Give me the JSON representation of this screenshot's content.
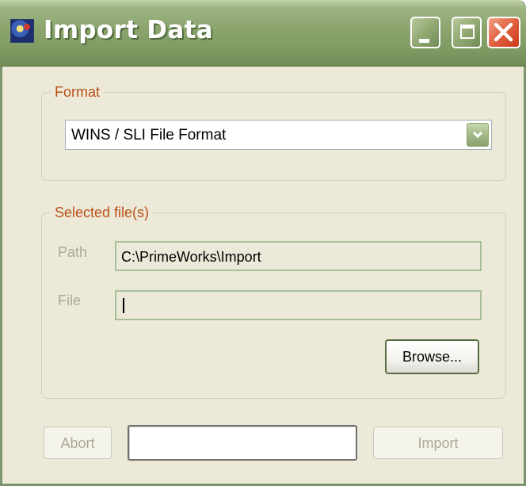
{
  "window": {
    "title": "Import Data",
    "colors": {
      "title_bar": "#8aa46c",
      "body": "#ECE9D8",
      "legend_text": "#b94f16",
      "close_button": "#e0603f"
    }
  },
  "format_group": {
    "legend": "Format",
    "selected_format": "WINS / SLI File Format"
  },
  "files_group": {
    "legend": "Selected file(s)",
    "path_label": "Path",
    "path_value": "C:\\PrimeWorks\\Import",
    "file_label": "File",
    "file_value": "",
    "browse_label": "Browse..."
  },
  "footer": {
    "abort_label": "Abort",
    "import_label": "Import",
    "progress_percent": 0
  },
  "icons": [
    "app-icon",
    "minimize-icon",
    "maximize-icon",
    "close-icon",
    "chevron-down-icon"
  ]
}
